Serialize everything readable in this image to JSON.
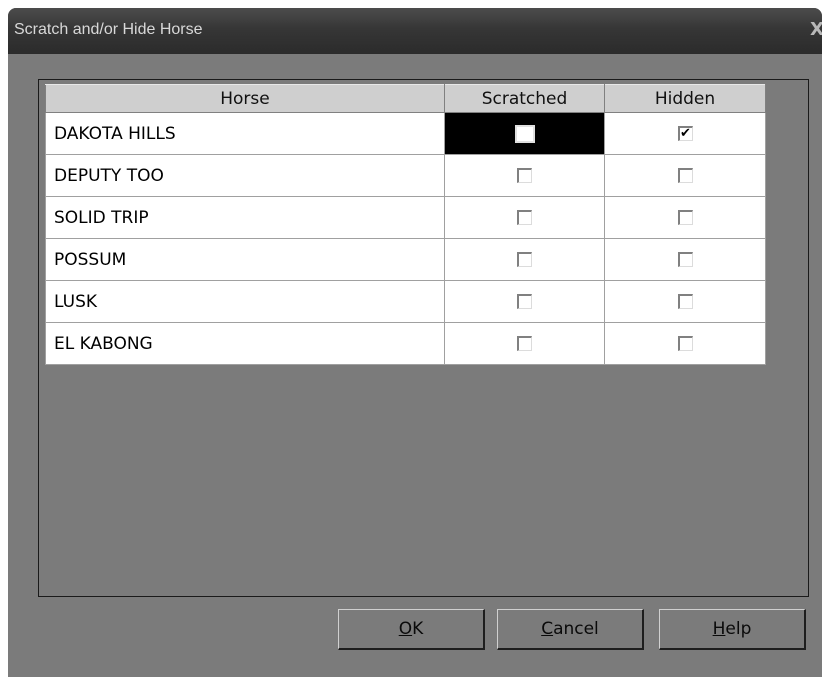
{
  "window": {
    "title": "Scratch and/or Hide Horse",
    "close_glyph": "X"
  },
  "grid": {
    "headers": [
      "Horse",
      "Scratched",
      "Hidden"
    ],
    "rows": [
      {
        "horse": "DAKOTA HILLS",
        "scratched": false,
        "hidden": true
      },
      {
        "horse": "DEPUTY TOO",
        "scratched": false,
        "hidden": false
      },
      {
        "horse": "SOLID TRIP",
        "scratched": false,
        "hidden": false
      },
      {
        "horse": "POSSUM",
        "scratched": false,
        "hidden": false
      },
      {
        "horse": "LUSK",
        "scratched": false,
        "hidden": false
      },
      {
        "horse": "EL KABONG",
        "scratched": false,
        "hidden": false
      }
    ]
  },
  "buttons": {
    "ok": {
      "accel": "O",
      "rest": "K"
    },
    "cancel": {
      "accel": "C",
      "rest": "ancel"
    },
    "help": {
      "accel": "H",
      "rest": "elp"
    }
  },
  "colors": {
    "dialog_bg": "#7b7b7b",
    "selected_cell": "#000000"
  }
}
